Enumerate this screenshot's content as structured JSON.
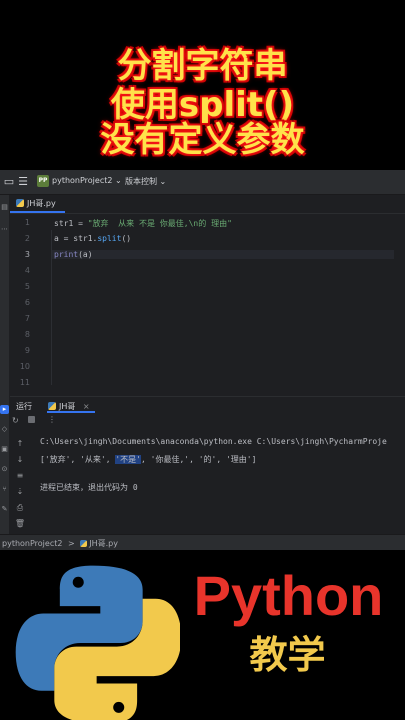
{
  "banner": {
    "line1": "分割字符串",
    "line2": "使用split()",
    "line3": "没有定义参数"
  },
  "ide": {
    "project_badge": "PP",
    "project_name": "pythonProject2",
    "project_chevron": "⌄",
    "vcs_label": "版本控制",
    "vcs_chevron": "⌄",
    "tab_name": "JH哥.py",
    "line_numbers": [
      "1",
      "2",
      "3",
      "4",
      "5",
      "6",
      "7",
      "8",
      "9",
      "10",
      "11"
    ],
    "code": {
      "line1_var": "str1 = ",
      "line1_str": "\"放弃  从来 不是 你最佳,\\n的 理由\"",
      "line2_pre": "a = str1.",
      "line2_fn": "split",
      "line2_post": "()",
      "line3_fn": "print",
      "line3_post": "(a)"
    },
    "run_label": "运行",
    "run_tab": "JH哥",
    "console": {
      "cmd": "C:\\Users\\jingh\\Documents\\anaconda\\python.exe C:\\Users\\jingh\\PycharmProje",
      "out_pre": "['放弃', '从来', ",
      "out_sel": "'不是'",
      "out_post": ", '你最佳,', '的', '理由']",
      "exit": "进程已结束，退出代码为 0"
    },
    "status_project": "pythonProject2",
    "status_sep": ">",
    "status_file": "JH哥.py"
  },
  "logo": {
    "text": "Python",
    "subtitle": "教学"
  },
  "colors": {
    "banner_text": "#ffe24a",
    "banner_glow": "#ff0000",
    "python_red": "#e8342b",
    "python_blue": "#3d7ab8",
    "python_yellow": "#f2c94c"
  }
}
